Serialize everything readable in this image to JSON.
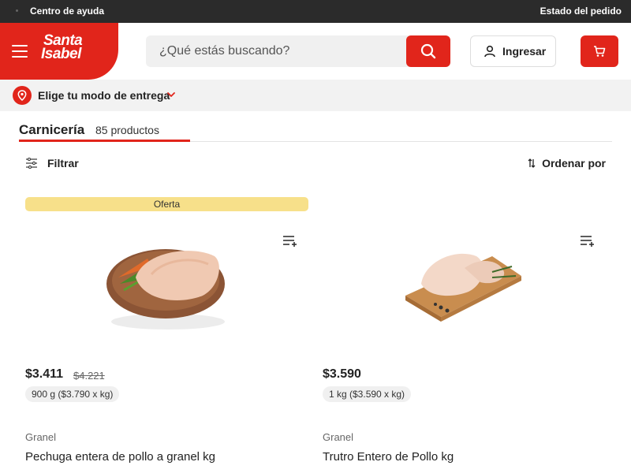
{
  "topbar": {
    "help_label": "Centro de ayuda",
    "order_status_label": "Estado del pedido"
  },
  "header": {
    "brand_line1": "Santa",
    "brand_line2": "Isabel",
    "search_placeholder": "¿Qué estás buscando?",
    "login_label": "Ingresar"
  },
  "delivery": {
    "label": "Elige tu modo de entrega"
  },
  "category": {
    "name": "Carnicería",
    "count": "85 productos"
  },
  "toolbar": {
    "filter_label": "Filtrar",
    "sort_label": "Ordenar por"
  },
  "products": [
    {
      "badge": "Oferta",
      "price": "$3.411",
      "old_price": "$4.221",
      "unit": "900 g ($3.790 x kg)",
      "brand": "Granel",
      "name": "Pechuga entera de pollo a granel kg"
    },
    {
      "price": "$3.590",
      "unit": "1 kg ($3.590 x kg)",
      "brand": "Granel",
      "name": "Trutro Entero de Pollo kg"
    }
  ],
  "colors": {
    "brand_red": "#e1251b",
    "topbar": "#2b2b2b",
    "offer_badge": "#f7e08a",
    "delivery_bar": "#f2f2f2"
  },
  "icons": [
    "menu-icon",
    "search-icon",
    "user-icon",
    "cart-icon",
    "location-pin-icon",
    "chevron-down-icon",
    "filter-icon",
    "sort-icon",
    "add-to-list-icon"
  ]
}
